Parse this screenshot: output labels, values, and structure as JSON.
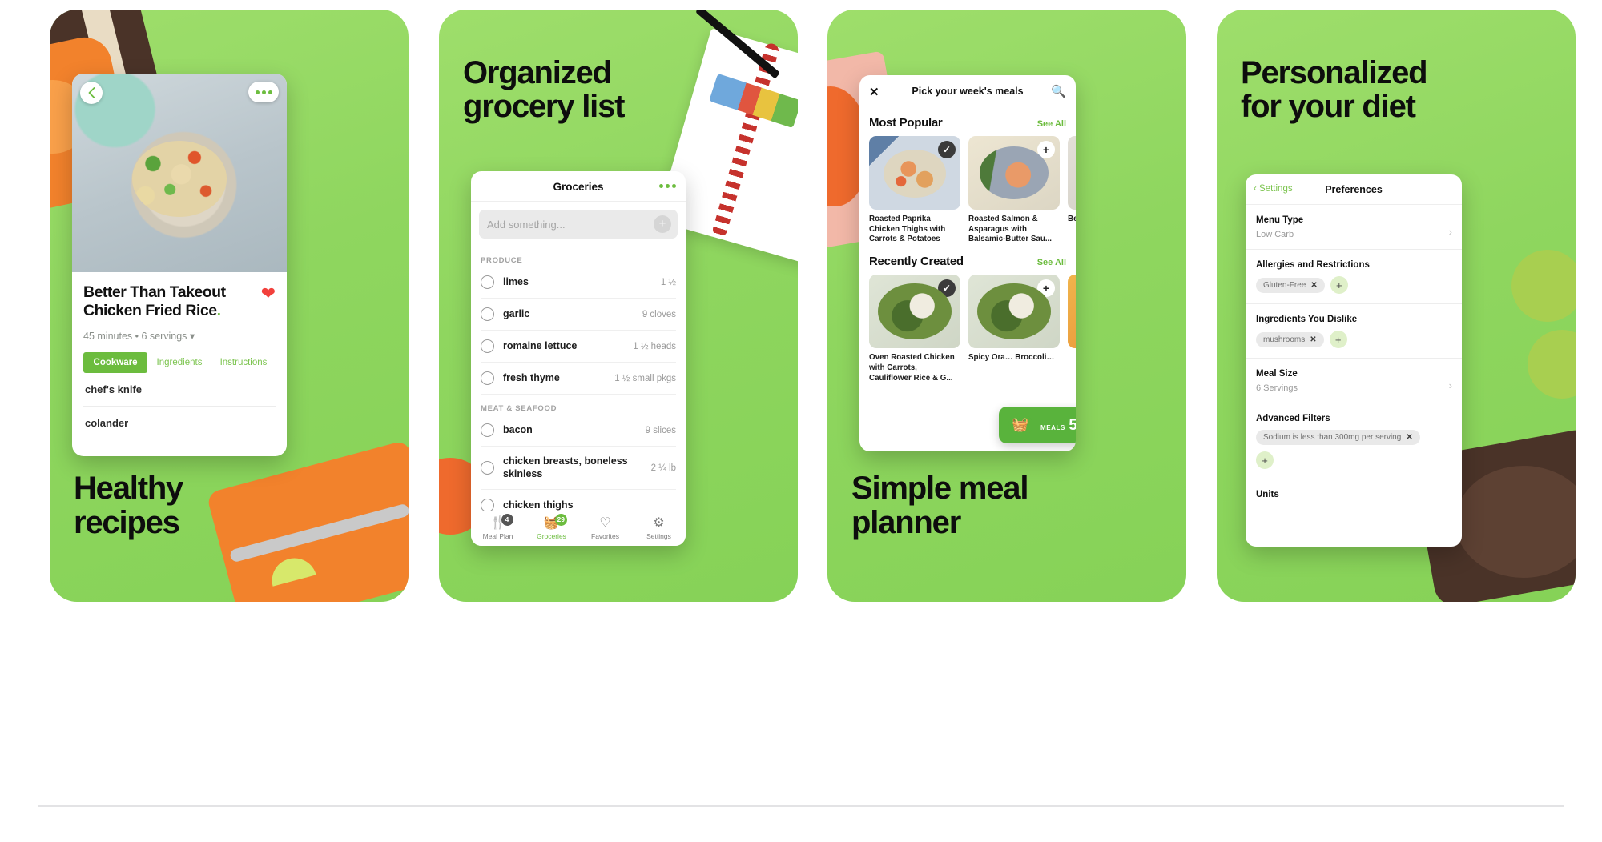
{
  "panels": [
    {
      "headline": "Healthy\nrecipes",
      "headline_position": "bottom",
      "recipe": {
        "back_icon": "chevron-left-icon",
        "more_icon": "more-options-icon",
        "title": "Better Than Takeout Chicken Fried Rice",
        "title_dot": ".",
        "favorite_icon": "heart-icon",
        "meta": "45 minutes • 6 servings ▾",
        "tabs": [
          {
            "label": "Cookware",
            "active": true
          },
          {
            "label": "Ingredients",
            "active": false
          },
          {
            "label": "Instructions",
            "active": false
          }
        ],
        "rows": [
          "chef's knife",
          "colander"
        ]
      }
    },
    {
      "headline": "Organized\ngrocery list",
      "headline_position": "top",
      "groceries": {
        "title": "Groceries",
        "more_icon": "more-options-icon",
        "add_placeholder": "Add something...",
        "add_icon": "plus-icon",
        "sections": [
          {
            "name": "PRODUCE",
            "items": [
              {
                "name": "limes",
                "qty": "1 ½"
              },
              {
                "name": "garlic",
                "qty": "9 cloves"
              },
              {
                "name": "romaine lettuce",
                "qty": "1 ½ heads"
              },
              {
                "name": "fresh thyme",
                "qty": "1 ½ small pkgs"
              }
            ]
          },
          {
            "name": "MEAT & SEAFOOD",
            "items": [
              {
                "name": "bacon",
                "qty": "9 slices"
              },
              {
                "name": "chicken breasts, boneless skinless",
                "qty": "2 ¼ lb"
              },
              {
                "name": "chicken thighs",
                "qty": ""
              }
            ]
          }
        ],
        "tabbar": [
          {
            "label": "Meal Plan",
            "icon": "utensils-icon",
            "glyph": "🍽",
            "badge": "4",
            "active": false
          },
          {
            "label": "Groceries",
            "icon": "basket-icon",
            "glyph": "🧺",
            "badge": "29",
            "active": true
          },
          {
            "label": "Favorites",
            "icon": "favorites-book-icon",
            "glyph": "♡",
            "badge": "",
            "active": false
          },
          {
            "label": "Settings",
            "icon": "gear-icon",
            "glyph": "⚙",
            "badge": "",
            "active": false
          }
        ]
      }
    },
    {
      "headline": "Simple meal\nplanner",
      "headline_position": "bottom",
      "picker": {
        "close_icon": "close-icon",
        "title": "Pick your week's meals",
        "search_icon": "search-icon",
        "sections": [
          {
            "heading": "Most Popular",
            "see_all": "See All",
            "meals": [
              {
                "name": "Roasted Paprika Chicken Thighs with Carrots & Potatoes",
                "state": "selected",
                "badge_icon": "check-icon"
              },
              {
                "name": "Roasted Salmon & Asparagus with Balsamic-Butter Sau...",
                "state": "unselected",
                "badge_icon": "plus-icon"
              },
              {
                "name": "Be… Fr…",
                "state": "unselected",
                "badge_icon": "plus-icon"
              }
            ]
          },
          {
            "heading": "Recently Created",
            "see_all": "See All",
            "meals": [
              {
                "name": "Oven Roasted Chicken with Carrots, Cauliflower Rice & G...",
                "state": "selected",
                "badge_icon": "check-icon"
              },
              {
                "name": "Spicy Ora… Broccoli…",
                "state": "unselected",
                "badge_icon": "plus-icon"
              },
              {
                "name": "",
                "state": "unselected",
                "badge_icon": "plus-icon"
              }
            ]
          }
        ],
        "basket": {
          "icon": "basket-icon",
          "label": "MEALS",
          "count": "5"
        }
      }
    },
    {
      "headline": "Personalized\nfor your diet",
      "headline_position": "top",
      "preferences": {
        "back_label": "Settings",
        "back_icon": "chevron-left-icon",
        "title": "Preferences",
        "groups": [
          {
            "label": "Menu Type",
            "value": "Low Carb",
            "chevron": true
          },
          {
            "label": "Allergies and Restrictions",
            "chips": [
              "Gluten-Free"
            ],
            "add_icon": "plus-icon"
          },
          {
            "label": "Ingredients You Dislike",
            "chips": [
              "mushrooms"
            ],
            "add_icon": "plus-icon"
          },
          {
            "label": "Meal Size",
            "value": "6 Servings",
            "chevron": true
          },
          {
            "label": "Advanced Filters",
            "chips": [
              "Sodium is less than 300mg per serving"
            ],
            "add_icon": "plus-icon"
          }
        ],
        "footer_label": "Units"
      }
    }
  ],
  "colors": {
    "panel_green": "#8fd65f",
    "accent_green": "#6cbc3e",
    "heart_red": "#f2403c",
    "chip_gray": "#e9e9e9",
    "text_dark": "#111111"
  }
}
